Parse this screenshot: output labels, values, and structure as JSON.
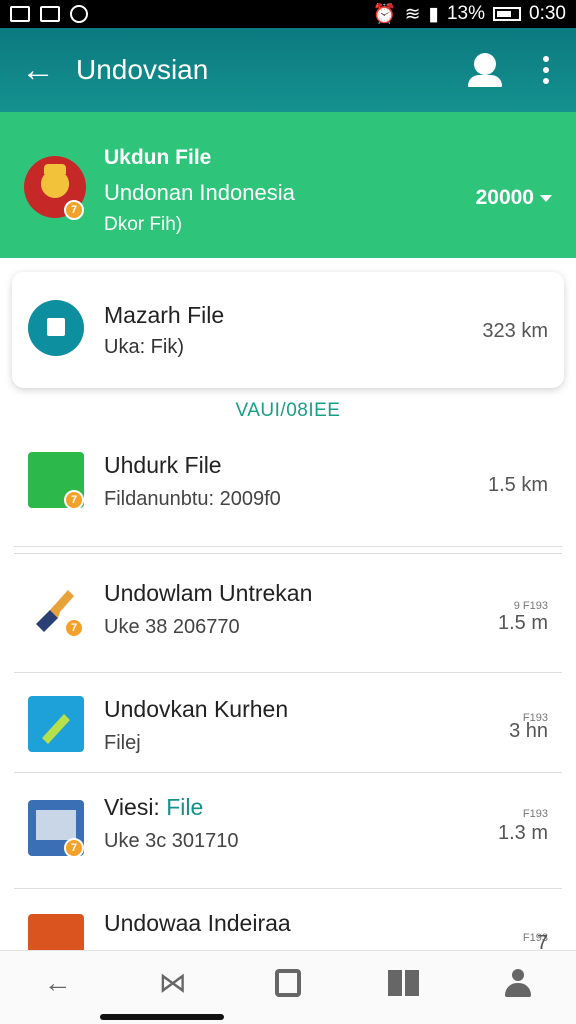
{
  "status_bar": {
    "battery": "13%",
    "time": "0:30"
  },
  "appbar": {
    "title": "Undovsian"
  },
  "hero": {
    "line1": "Ukdun File",
    "line2": "Undonan Indonesia",
    "line3": "Dkor Fih)",
    "value": "20000",
    "badge": "7"
  },
  "card": {
    "title": "Mazarh File",
    "subtitle": "Uka: Fik)",
    "size": "323 km"
  },
  "section_label": "VAUI/08IEE",
  "list": [
    {
      "title": "Uhdurk File",
      "subtitle": "Fildanunbtu: 2009f0",
      "size": "1.5 km",
      "size_top": "",
      "badge": "7"
    },
    {
      "title": "Undowlam Untrekan",
      "subtitle": "Uke 38 206770",
      "size": "1.5 m",
      "size_top": "9 F193",
      "badge": "7"
    },
    {
      "title": "Undovkan Kurhen",
      "subtitle": "Filej",
      "size": "3 hn",
      "size_top": "F193",
      "badge": ""
    },
    {
      "title_prefix": "Viesi: ",
      "title_highlight": "File",
      "subtitle": "Uke 3c 301710",
      "size": "1.3 m",
      "size_top": "F193",
      "badge": "7"
    },
    {
      "title": "Undowaa Indeiraa",
      "subtitle": "",
      "size": "7",
      "size_top": "F193",
      "badge": ""
    }
  ],
  "colors": {
    "appbar": "#0c7a80",
    "hero": "#2ec57a",
    "accent": "#14918f",
    "badge": "#f4a12a"
  }
}
